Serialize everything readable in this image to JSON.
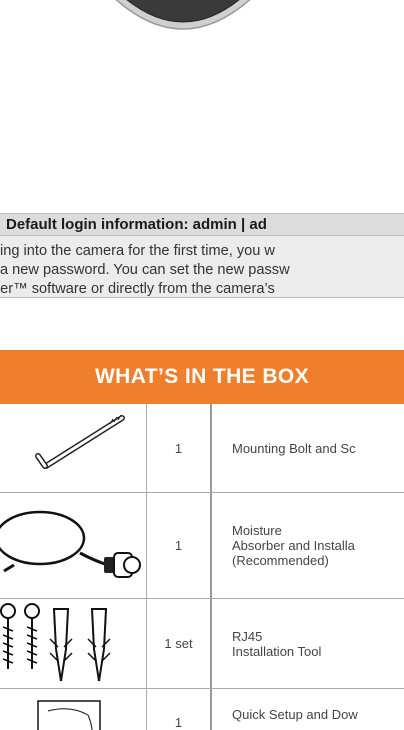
{
  "login_bar": {
    "text": "Default login information: admin | ad"
  },
  "info_lines": [
    "ing into the camera for the first time, you w",
    "a new password. You can set the new passw",
    "der™ software or directly from the camera’s"
  ],
  "section_title": "WHAT’S IN THE BOX",
  "items": [
    {
      "qty": "1",
      "lines": [
        "Mounting Bolt and Sc"
      ],
      "icon": "allen-key-icon"
    },
    {
      "qty": "1",
      "lines": [
        "Moisture",
        "Absorber and Installa",
        "(Recommended)"
      ],
      "icon": "cable-connector-icon"
    },
    {
      "qty": "1 set",
      "lines": [
        "RJ45",
        "Installation Tool"
      ],
      "icon": "screws-anchors-icon"
    },
    {
      "qty": "1",
      "lines": [
        "Quick Setup and Dow"
      ],
      "icon": "mounting-template-icon"
    }
  ],
  "colors": {
    "header_bg": "#ef7e2d",
    "login_bar_bg": "#dcdcdc",
    "info_bg": "#ececec"
  }
}
